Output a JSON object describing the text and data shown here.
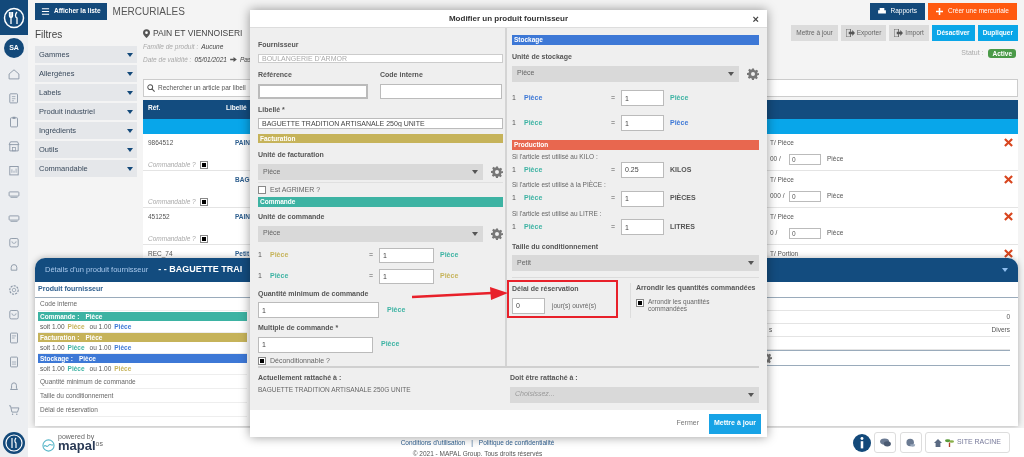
{
  "sidebar": {
    "avatar": "SA"
  },
  "topbar": {
    "list_button": "Afficher la liste",
    "title": "MERCURIALES",
    "buttons": [
      {
        "label": "Rapports",
        "kind": "report"
      },
      {
        "label": "Créer une mercuriale",
        "kind": "create"
      }
    ]
  },
  "filters": {
    "title": "Filtres",
    "items": [
      "Gammes",
      "Allergènes",
      "Labels",
      "Produit industriel",
      "Ingrédients",
      "Outils",
      "Commandable"
    ]
  },
  "header": {
    "title": "PAIN ET VIENNOISERI",
    "family_label": "Famille de produit :",
    "family": "Aucune",
    "date_label": "Date de validité :",
    "date": "05/01/2021",
    "date_to": "Pas"
  },
  "actions": [
    {
      "label": "Mettre à jour",
      "kind": "plain"
    },
    {
      "label": "Exporter",
      "kind": "export"
    },
    {
      "label": "Import",
      "kind": "import"
    },
    {
      "label": "Désactiver",
      "kind": "primary"
    },
    {
      "label": "Dupliquer",
      "kind": "primary"
    }
  ],
  "status": {
    "label": "Statut :",
    "value": "Active"
  },
  "search": {
    "placeholder": "Rechercher un article par libell"
  },
  "table": {
    "columns": [
      "Réf.",
      "Libellé"
    ],
    "rows": [
      {
        "ref": "9864512",
        "name": "PAIN",
        "commandable_label": "Commandable ?",
        "commandable": true,
        "price_unit": "T/ Pièce",
        "qty_prefix": "00 /",
        "qty": "0",
        "qty_unit": "Pièce"
      },
      {
        "name": "BAG",
        "commandable_label": "Commandable ?",
        "commandable": true,
        "price_unit": "T/ Pièce",
        "qty_prefix": "000 /",
        "qty": "0",
        "qty_unit": "Pièce"
      },
      {
        "ref": "451252",
        "name": "PAIN",
        "commandable_label": "Commandable ?",
        "commandable": true,
        "price_unit": "T/ Pièce",
        "qty_prefix": "0 /",
        "qty": "0",
        "qty_unit": "Pièce"
      },
      {
        "ref": "REC_74",
        "name": "Petit",
        "price_unit": "T/ Portion"
      }
    ]
  },
  "details_panel": {
    "title": "Détails d'un produit fournisseur",
    "subtitle": "- - BAGUETTE TRAI",
    "section": "Produit fournisseur",
    "rows": [
      {
        "kind": "plain",
        "label": "Code interne"
      },
      {
        "kind": "unit",
        "label": "Commande :",
        "unit": "Pièce",
        "color": "#3db3a3",
        "soit": "soit 1.00",
        "u1": {
          "text": "Pièce",
          "kind": "billing"
        },
        "ou": "ou 1.00",
        "u2": {
          "text": "Pièce",
          "kind": "storage"
        }
      },
      {
        "kind": "unit",
        "label": "Facturation :",
        "unit": "Pièce",
        "color": "#c6b35a",
        "soit": "soit 1.00",
        "u1": {
          "text": "Pièce",
          "kind": "order"
        },
        "ou": "ou 1.00",
        "u2": {
          "text": "Pièce",
          "kind": "storage"
        }
      },
      {
        "kind": "unit",
        "label": "Stockage :",
        "unit": "Pièce",
        "color": "#3d78d6",
        "soit": "soit 1.00",
        "u1": {
          "text": "Pièce",
          "kind": "order"
        },
        "ou": "ou 1.00",
        "u2": {
          "text": "Pièce",
          "kind": "billing"
        }
      },
      {
        "kind": "plain",
        "label": "Quantité minimum de commande"
      },
      {
        "kind": "plain",
        "label": "Taille du conditionnement"
      },
      {
        "kind": "plain",
        "label": "Délai de réservation"
      }
    ],
    "side_rows": [
      {
        "kind": "blank"
      },
      {
        "kind": "value",
        "value": "0"
      },
      {
        "kind": "value",
        "label": "s",
        "value": "Divers"
      },
      {
        "kind": "blank"
      },
      {
        "kind": "gear"
      }
    ]
  },
  "modal": {
    "title": "Modifier un produit fournisseur",
    "close": "×",
    "left": {
      "supplier": {
        "label": "Fournisseur",
        "value": "BOULANGERIE D'ARMOR"
      },
      "reference": {
        "label": "Référence",
        "focused": true
      },
      "internal_code": {
        "label": "Code interne"
      },
      "name": {
        "label": "Libellé *",
        "value": "BAGUETTE TRADITION ARTISANALE 250g UNITE"
      },
      "billing": {
        "title": "Facturation",
        "color": "#c6b35a",
        "unit_label": "Unité de facturation",
        "unit": "Pièce"
      },
      "agrimer": {
        "label": "Est AGRIMER ?",
        "checked": false
      },
      "order": {
        "title": "Commande",
        "color": "#3db3a3",
        "unit_label": "Unité de commande",
        "unit": "Pièce",
        "conversions": [
          {
            "qty": "1",
            "unit": {
              "text": "Pièce",
              "kind": "billing"
            },
            "eq": "=",
            "value": "1",
            "target": {
              "text": "Pièce",
              "kind": "order"
            }
          },
          {
            "qty": "1",
            "unit": {
              "text": "Pièce",
              "kind": "order"
            },
            "eq": "=",
            "value": "1",
            "target": {
              "text": "Pièce",
              "kind": "billing"
            }
          }
        ]
      },
      "min_qty": {
        "label": "Quantité minimum de commande",
        "value": "1",
        "unit": {
          "text": "Pièce",
          "kind": "order"
        }
      },
      "multiple": {
        "label": "Multiple de commande *",
        "value": "1",
        "unit": {
          "text": "Pièce",
          "kind": "order"
        }
      },
      "deconditionable": {
        "label": "Déconditionnable ?",
        "checked": true
      },
      "attached": {
        "label": "Actuellement rattaché à :",
        "value": "BAGUETTE TRADITION ARTISANALE 250G UNITE"
      }
    },
    "right": {
      "storage": {
        "title": "Stockage",
        "color": "#3d78d6",
        "unit_label": "Unité de stockage",
        "unit": "Pièce",
        "conversions": [
          {
            "qty": "1",
            "unit": {
              "text": "Pièce",
              "kind": "storage"
            },
            "eq": "=",
            "value": "1",
            "target": {
              "text": "Pièce",
              "kind": "order"
            }
          },
          {
            "qty": "1",
            "unit": {
              "text": "Pièce",
              "kind": "order"
            },
            "eq": "=",
            "value": "1",
            "target": {
              "text": "Pièce",
              "kind": "storage"
            }
          }
        ]
      },
      "production": {
        "title": "Production",
        "color": "#e8674f",
        "rules": [
          {
            "label": "Si l'article est utilisé au KILO :",
            "qty": "1",
            "unit": {
              "text": "Pièce",
              "kind": "order"
            },
            "eq": "=",
            "value": "0.25",
            "target": "KILOS"
          },
          {
            "label": "Si l'article est utilisé à la PIÈCE :",
            "qty": "1",
            "unit": {
              "text": "Pièce",
              "kind": "order"
            },
            "eq": "=",
            "value": "1",
            "target": "PIÈCES"
          },
          {
            "label": "Si l'article est utilisé au LITRE :",
            "qty": "1",
            "unit": {
              "text": "Pièce",
              "kind": "order"
            },
            "eq": "=",
            "value": "1",
            "target": "LITRES"
          }
        ]
      },
      "package_size": {
        "label": "Taille du conditionnement",
        "value": "Petit"
      },
      "lead_time": {
        "label": "Délai de réservation",
        "value": "0",
        "unit": "jour(s) ouvré(s)"
      },
      "rounding": {
        "title": "Arrondir les quantités commandées",
        "label": "Arrondir les quantités commandées",
        "checked": true
      },
      "attach_to": {
        "label": "Doit être rattaché à :",
        "placeholder": "Choisissez..."
      }
    },
    "footer": {
      "cancel": "Fermer",
      "submit": "Mettre à jour"
    }
  },
  "footer": {
    "powered_by": "powered by",
    "brand": "mapal",
    "brand_suffix": "os",
    "links": [
      "Conditions d'utilisation",
      "Politique de confidentialité"
    ],
    "separator": "|",
    "copyright": "© 2021 - MAPAL Group. Tous droits réservés",
    "site_button": "SITE RACINE"
  }
}
